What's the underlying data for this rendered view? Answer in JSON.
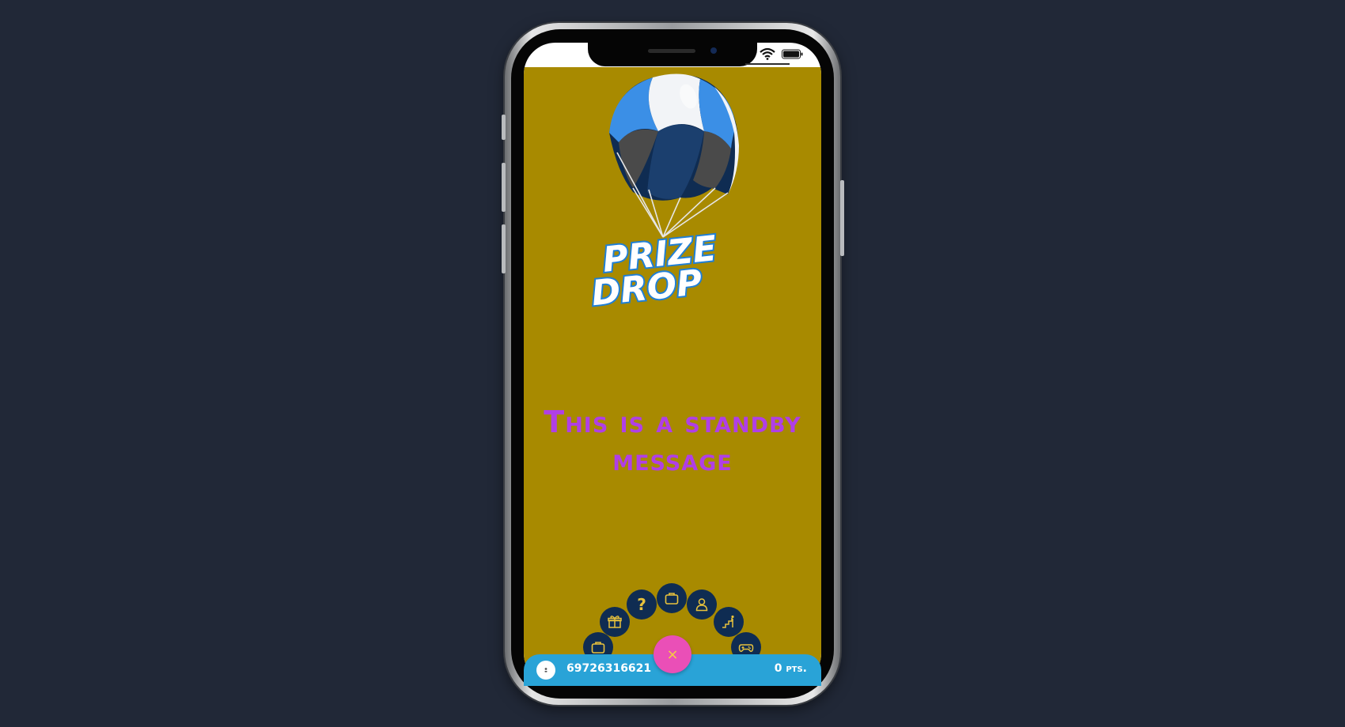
{
  "app": {
    "logo_line1": "PRIZE",
    "logo_line2": "DROP",
    "standby_message": "This is a standby message",
    "colors": {
      "background": "#a88a00",
      "message": "#b03fe6",
      "bar": "#29a3d7",
      "menu_button": "#0f2c52",
      "menu_icon": "#e8c23c",
      "close_button": "#ea4fb7"
    }
  },
  "menu": {
    "items": [
      {
        "icon": "briefcase-icon"
      },
      {
        "icon": "gift-icon"
      },
      {
        "icon": "help-icon",
        "glyph": "?"
      },
      {
        "icon": "briefcase-icon"
      },
      {
        "icon": "user-icon"
      },
      {
        "icon": "leaderboard-icon"
      },
      {
        "icon": "gamepad-icon"
      }
    ],
    "close_glyph": "×"
  },
  "bottom_bar": {
    "phone_number": "69726316621",
    "points": "0 pts."
  }
}
